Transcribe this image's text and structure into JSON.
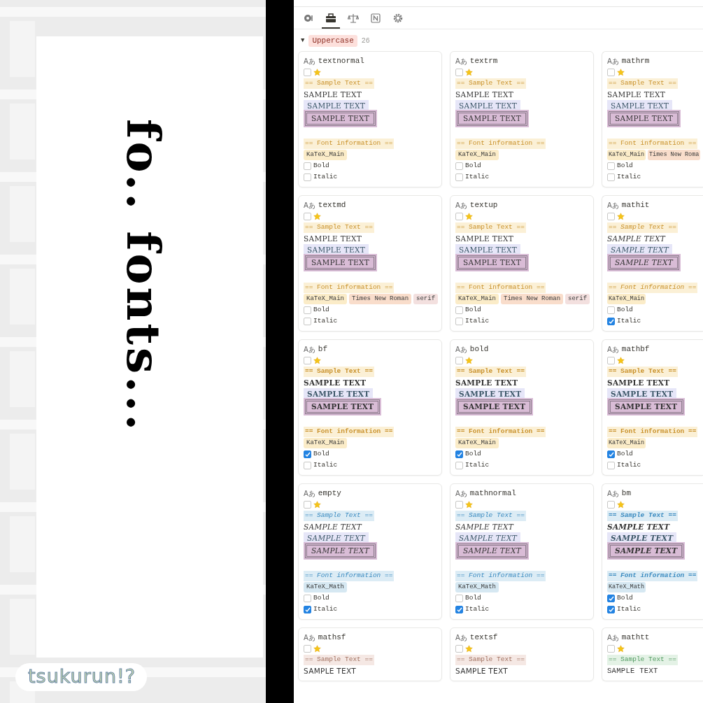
{
  "cover": {
    "title": "fo.. fonts...",
    "logo": "tsukurun!?"
  },
  "toolbar": [
    {
      "kind": "disc",
      "selected": false
    },
    {
      "kind": "toolbox",
      "selected": true
    },
    {
      "kind": "scales",
      "selected": false
    },
    {
      "kind": "notion",
      "selected": false
    },
    {
      "kind": "gear",
      "selected": false
    }
  ],
  "group": {
    "toggle": "▼",
    "label": "Uppercase",
    "count": "26",
    "expanded": true
  },
  "cards": [
    {
      "icon": "Aあ",
      "name": "textnormal",
      "favorite": false,
      "kind": "main",
      "sample_header": "== Sample Text ==",
      "samples": [
        "SAMPLE TEXT",
        "SAMPLE TEXT",
        "SAMPLE TEXT"
      ],
      "info_header": "== Font information ==",
      "fonts": [
        {
          "label": "KaTeX_Main",
          "color": "#fbecc8"
        }
      ],
      "bold": false,
      "italic": false,
      "bold_label": "Bold",
      "italic_label": "Italic"
    },
    {
      "icon": "Aあ",
      "name": "textrm",
      "favorite": false,
      "kind": "main",
      "sample_header": "== Sample Text ==",
      "samples": [
        "SAMPLE TEXT",
        "SAMPLE TEXT",
        "SAMPLE TEXT"
      ],
      "info_header": "== Font information ==",
      "fonts": [
        {
          "label": "KaTeX_Main",
          "color": "#fbecc8"
        }
      ],
      "bold": false,
      "italic": false,
      "bold_label": "Bold",
      "italic_label": "Italic"
    },
    {
      "icon": "Aあ",
      "name": "mathrm",
      "favorite": false,
      "kind": "main",
      "sample_header": "== Sample Text ==",
      "samples": [
        "SAMPLE TEXT",
        "SAMPLE TEXT",
        "SAMPLE TEXT"
      ],
      "info_header": "== Font information ==",
      "fonts": [
        {
          "label": "KaTeX_Main",
          "color": "#fbecc8"
        },
        {
          "label": "Times New Roma",
          "color": "#f9ddcb"
        }
      ],
      "bold": false,
      "italic": false,
      "bold_label": "Bold",
      "italic_label": "Italic"
    },
    {
      "icon": "Aあ",
      "name": "textmd",
      "favorite": false,
      "kind": "main",
      "sample_header": "== Sample Text ==",
      "samples": [
        "SAMPLE TEXT",
        "SAMPLE TEXT",
        "SAMPLE TEXT"
      ],
      "info_header": "== Font information ==",
      "fonts": [
        {
          "label": "KaTeX_Main",
          "color": "#fbecc8"
        },
        {
          "label": "Times New Roman",
          "color": "#f9ddcb"
        },
        {
          "label": "serif",
          "color": "#f3e0df"
        }
      ],
      "bold": false,
      "italic": false,
      "bold_label": "Bold",
      "italic_label": "Italic"
    },
    {
      "icon": "Aあ",
      "name": "textup",
      "favorite": false,
      "kind": "main",
      "sample_header": "== Sample Text ==",
      "samples": [
        "SAMPLE TEXT",
        "SAMPLE TEXT",
        "SAMPLE TEXT"
      ],
      "info_header": "== Font information ==",
      "fonts": [
        {
          "label": "KaTeX_Main",
          "color": "#fbecc8"
        },
        {
          "label": "Times New Roman",
          "color": "#f9ddcb"
        },
        {
          "label": "serif",
          "color": "#f3e0df"
        }
      ],
      "bold": false,
      "italic": false,
      "bold_label": "Bold",
      "italic_label": "Italic"
    },
    {
      "icon": "Aあ",
      "name": "mathit",
      "favorite": false,
      "kind": "main",
      "sample_header": "== Sample Text ==",
      "samples": [
        "SAMPLE TEXT",
        "SAMPLE TEXT",
        "SAMPLE TEXT"
      ],
      "info_header": "== Font information ==",
      "fonts": [
        {
          "label": "KaTeX_Main",
          "color": "#fbecc8"
        }
      ],
      "bold": false,
      "italic": true,
      "bold_label": "Bold",
      "italic_label": "Italic"
    },
    {
      "icon": "Aあ",
      "name": "bf",
      "favorite": false,
      "kind": "main",
      "sample_header": "== Sample Text ==",
      "samples": [
        "SAMPLE TEXT",
        "SAMPLE TEXT",
        "SAMPLE TEXT"
      ],
      "info_header": "== Font information ==",
      "fonts": [
        {
          "label": "KaTeX_Main",
          "color": "#fbecc8"
        }
      ],
      "bold": true,
      "italic": false,
      "bold_label": "Bold",
      "italic_label": "Italic"
    },
    {
      "icon": "Aあ",
      "name": "bold",
      "favorite": false,
      "kind": "main",
      "sample_header": "== Sample Text ==",
      "samples": [
        "SAMPLE TEXT",
        "SAMPLE TEXT",
        "SAMPLE TEXT"
      ],
      "info_header": "== Font information ==",
      "fonts": [
        {
          "label": "KaTeX_Main",
          "color": "#fbecc8"
        }
      ],
      "bold": true,
      "italic": false,
      "bold_label": "Bold",
      "italic_label": "Italic"
    },
    {
      "icon": "Aあ",
      "name": "mathbf",
      "favorite": false,
      "kind": "main",
      "sample_header": "== Sample Text ==",
      "samples": [
        "SAMPLE TEXT",
        "SAMPLE TEXT",
        "SAMPLE TEXT"
      ],
      "info_header": "== Font information ==",
      "fonts": [
        {
          "label": "KaTeX_Main",
          "color": "#fbecc8"
        }
      ],
      "bold": true,
      "italic": false,
      "bold_label": "Bold",
      "italic_label": "Italic"
    },
    {
      "icon": "Aあ",
      "name": "empty",
      "favorite": false,
      "kind": "math",
      "sample_header": "== Sample Text ==",
      "samples": [
        "SAMPLE TEXT",
        "SAMPLE TEXT",
        "SAMPLE TEXT"
      ],
      "info_header": "== Font information ==",
      "fonts": [
        {
          "label": "KaTeX_Math",
          "color": "#d6e8f2"
        }
      ],
      "bold": false,
      "italic": true,
      "bold_label": "Bold",
      "italic_label": "Italic"
    },
    {
      "icon": "Aあ",
      "name": "mathnormal",
      "favorite": false,
      "kind": "math",
      "sample_header": "== Sample Text ==",
      "samples": [
        "SAMPLE TEXT",
        "SAMPLE TEXT",
        "SAMPLE TEXT"
      ],
      "info_header": "== Font information ==",
      "fonts": [
        {
          "label": "KaTeX_Math",
          "color": "#d6e8f2"
        }
      ],
      "bold": false,
      "italic": true,
      "bold_label": "Bold",
      "italic_label": "Italic"
    },
    {
      "icon": "Aあ",
      "name": "bm",
      "favorite": false,
      "kind": "math",
      "sample_header": "== Sample Text ==",
      "samples": [
        "SAMPLE TEXT",
        "SAMPLE TEXT",
        "SAMPLE TEXT"
      ],
      "info_header": "== Font information ==",
      "fonts": [
        {
          "label": "KaTeX_Math",
          "color": "#d6e8f2"
        }
      ],
      "bold": true,
      "italic": true,
      "bold_label": "Bold",
      "italic_label": "Italic"
    },
    {
      "icon": "Aあ",
      "name": "mathsf",
      "favorite": false,
      "kind": "sans",
      "sample_header": "== Sample Text ==",
      "samples": [
        "SAMPLE TEXT"
      ]
    },
    {
      "icon": "Aあ",
      "name": "textsf",
      "favorite": false,
      "kind": "sans",
      "sample_header": "== Sample Text ==",
      "samples": [
        "SAMPLE TEXT"
      ]
    },
    {
      "icon": "Aあ",
      "name": "mathtt",
      "favorite": false,
      "kind": "mono",
      "sample_header": "== Sample Text ==",
      "samples": [
        "SAMPLE TEXT"
      ]
    }
  ]
}
